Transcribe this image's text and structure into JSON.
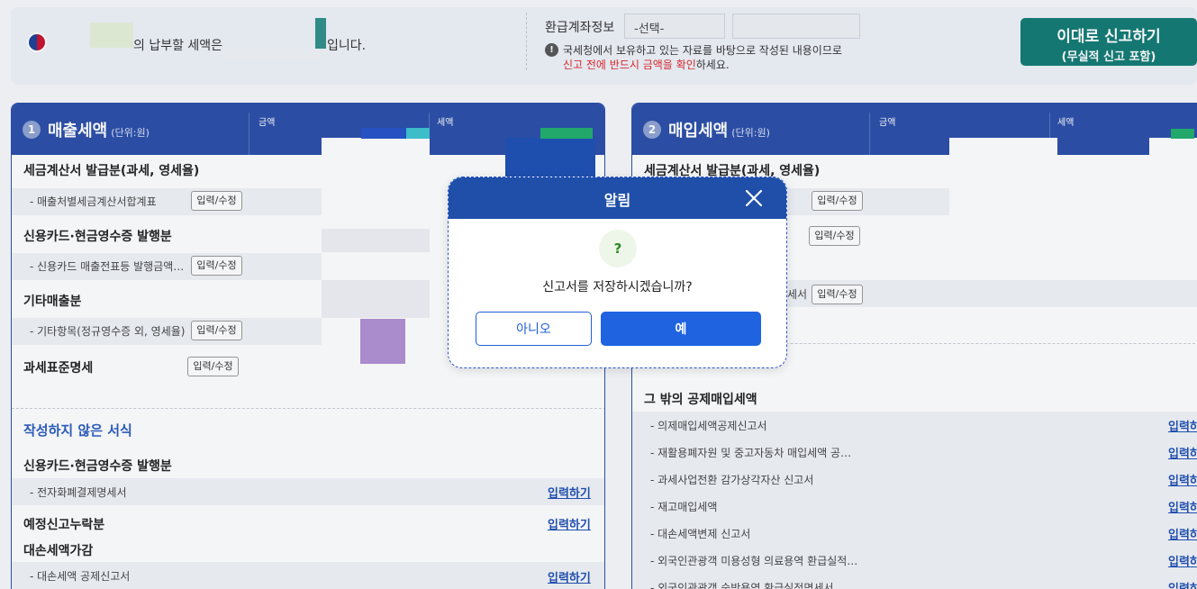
{
  "summary": {
    "tax_prefix": "의 납부할 세액은",
    "tax_suffix": "입니다.",
    "refund_label": "환급계좌정보",
    "refund_select_value": "-선택-",
    "notice_line1": "국세청에서 보유하고 있는 자료를 바탕으로 작성된 내용이므로",
    "notice_line2_red": "신고 전에 반드시 금액을 확인",
    "notice_line2_rest": "하세요.",
    "submit_line1": "이대로 신고하기",
    "submit_line2": "(무실적 신고 포함)"
  },
  "sales_panel": {
    "number": "1",
    "title": "매출세액",
    "unit": "(단위:원)",
    "col_amount": "금액",
    "col_tax": "세액",
    "sec_invoice": "세금계산서 발급분(과세, 영세율)",
    "sub_invoice": "- 매출처별세금계산서합계표",
    "sec_card": "신용카드·현금영수증 발행분",
    "sub_card": "- 신용카드 매출전표등 발행금액…",
    "sec_etc": "기타매출분",
    "sub_etc": "- 기타항목(정규영수증 외, 영세율)",
    "sec_standard": "과세표준명세",
    "edit_label": "입력/수정",
    "unwritten_title": "작성하지 않은 서식",
    "u_sec_card": "신용카드·현금영수증 발행분",
    "u_sub_epay": "- 전자화폐결제명세서",
    "u_sec_omit": "예정신고누락분",
    "u_sec_baddebt": "대손세액가감",
    "u_sub_baddebt": "- 대손세액 공제신고서",
    "input_link": "입력하기"
  },
  "purchase_panel": {
    "number": "2",
    "title": "매입세액",
    "unit": "(단위:원)",
    "col_amount": "금액",
    "col_tax": "세액",
    "sec_invoice": "세금계산서 발급분(과세, 영세율)",
    "edit_label": "입력/수정",
    "partial_text": "세서",
    "sec_other": "그 밖의 공제매입세액",
    "items": [
      "- 의제매입세액공제신고서",
      "- 재활용폐자원 및 중고자동차 매입세액 공…",
      "- 과세사업전환 감가상각자산 신고서",
      "- 재고매입세액",
      "- 대손세액변제 신고서",
      "- 외국인관광객 미용성형 의료용역 환급실적…",
      "- 외국인관광객 숙박용역 환급실적명세서"
    ],
    "input_link_partial": "입력하"
  },
  "dialog": {
    "title": "알림",
    "icon_text": "?",
    "message": "신고서를 저장하시겠습니까?",
    "no_label": "아니오",
    "yes_label": "예"
  },
  "colors": {
    "header_blue": "#2a4da8",
    "submit_teal": "#117a73",
    "dialog_header": "#1f4fa8",
    "primary_button": "#1f63e0",
    "notice_red": "#e0262b"
  }
}
